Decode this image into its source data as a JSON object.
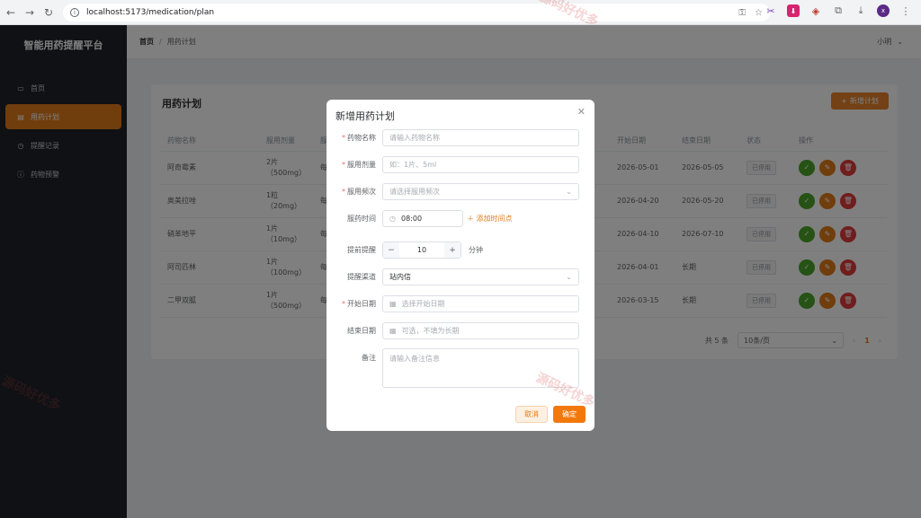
{
  "browser": {
    "url": "localhost:5173/medication/plan",
    "profile_initial": "x"
  },
  "sidebar": {
    "brand": "智能用药提醒平台",
    "items": [
      {
        "label": "首页",
        "icon": "monitor-icon"
      },
      {
        "label": "用药计划",
        "icon": "document-icon"
      },
      {
        "label": "提醒记录",
        "icon": "clock-icon"
      },
      {
        "label": "药物预警",
        "icon": "warning-icon"
      }
    ]
  },
  "header": {
    "breadcrumb_home": "首页",
    "breadcrumb_sep": "/",
    "breadcrumb_current": "用药计划",
    "user": "小明"
  },
  "card": {
    "title": "用药计划",
    "add_button": "新增计划",
    "columns": [
      "药物名称",
      "服用剂量",
      "服",
      "",
      "",
      "",
      "",
      "开始日期",
      "结束日期",
      "状态",
      "操作"
    ],
    "rows": [
      {
        "name": "阿奇霉素",
        "dose1": "2片",
        "dose2": "（500mg）",
        "freq": "每",
        "start": "2026-05-01",
        "end": "2026-05-05",
        "status": "已停用"
      },
      {
        "name": "奥美拉唑",
        "dose1": "1粒",
        "dose2": "（20mg）",
        "freq": "每",
        "start": "2026-04-20",
        "end": "2026-05-20",
        "status": "已停用"
      },
      {
        "name": "硝苯地平",
        "dose1": "1片",
        "dose2": "（10mg）",
        "freq": "每",
        "start": "2026-04-10",
        "end": "2026-07-10",
        "status": "已停用"
      },
      {
        "name": "阿司匹林",
        "dose1": "1片",
        "dose2": "（100mg）",
        "freq": "每",
        "start": "2026-04-01",
        "end": "长期",
        "status": "已停用"
      },
      {
        "name": "二甲双胍",
        "dose1": "1片",
        "dose2": "（500mg）",
        "freq": "每",
        "start": "2026-03-15",
        "end": "长期",
        "status": "已停用"
      }
    ],
    "pager": {
      "total": "共 5 条",
      "page_size": "10条/页",
      "page": "1"
    }
  },
  "dialog": {
    "title": "新增用药计划",
    "fields": {
      "name_label": "药物名称",
      "name_placeholder": "请输入药物名称",
      "dose_label": "服用剂量",
      "dose_placeholder": "如：1片、5ml",
      "freq_label": "服用频次",
      "freq_placeholder": "请选择服用频次",
      "time_label": "服药时间",
      "time_value": "08:00",
      "add_time": "添加时间点",
      "remind_label": "提前提醒",
      "remind_value": "10",
      "remind_unit": "分钟",
      "channel_label": "提醒渠道",
      "channel_value": "站内信",
      "start_label": "开始日期",
      "start_placeholder": "选择开始日期",
      "end_label": "结束日期",
      "end_placeholder": "可选，不填为长期",
      "note_label": "备注",
      "note_placeholder": "请输入备注信息"
    },
    "cancel": "取消",
    "confirm": "确定"
  },
  "watermark": "源码好优多",
  "colors": {
    "accent": "#e07b18",
    "sidebar_bg": "#1f2229",
    "success": "#4ca52a",
    "danger": "#e03b3b"
  }
}
